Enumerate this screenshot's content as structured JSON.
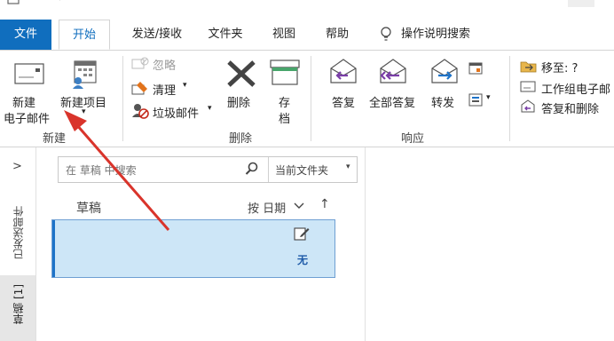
{
  "tabs": {
    "file": "文件",
    "home": "开始",
    "send_receive": "发送/接收",
    "folder": "文件夹",
    "view": "视图",
    "help": "帮助",
    "tell_me": "操作说明搜索"
  },
  "ribbon": {
    "new_group": {
      "new_email_line1": "新建",
      "new_email_line2": "电子邮件",
      "new_items": "新建项目",
      "group_label": "新建"
    },
    "delete_group": {
      "ignore": "忽略",
      "clean_up": "清理",
      "junk": "垃圾邮件",
      "delete": "删除",
      "archive_line1": "存",
      "archive_line2": "档",
      "group_label": "删除"
    },
    "respond_group": {
      "reply": "答复",
      "reply_all": "全部答复",
      "forward": "转发",
      "group_label": "响应"
    },
    "quick_steps": {
      "move_to": "移至: ?",
      "team_email": "工作组电子邮",
      "reply_delete": "答复和删除"
    }
  },
  "nav": {
    "expand": ">",
    "sent_items": "已发送邮件",
    "drafts": "草稿 [1]"
  },
  "search": {
    "placeholder": "在 草稿 中搜索",
    "scope": "当前文件夹"
  },
  "list": {
    "folder_name": "草稿",
    "sort_label": "按 日期",
    "sort_direction": "↑",
    "items": [
      {
        "subject": "无"
      }
    ]
  },
  "colors": {
    "accent": "#106ebe",
    "selection": "#cde6f7",
    "arrow": "#d9342b"
  }
}
